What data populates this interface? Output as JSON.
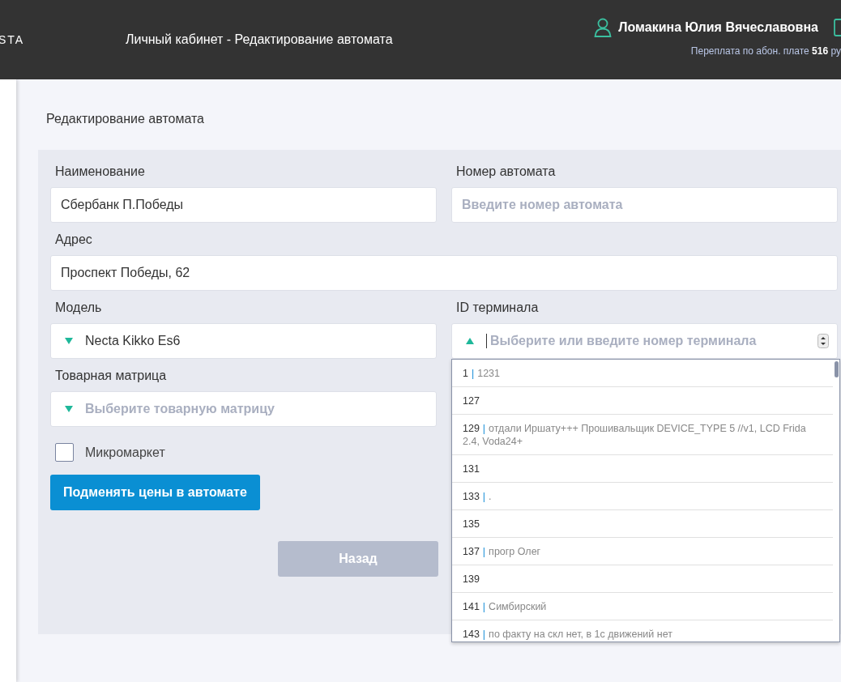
{
  "header": {
    "logo": "STA",
    "title": "Личный кабинет - Редактирование автомата",
    "user_name": "Ломакина Юлия Вячеславовна",
    "balance_note": "Переплата по абон. плате **516** ру"
  },
  "page_title": "Редактирование автомата",
  "fields": [
    {
      "label": "Наименование",
      "kind": "text",
      "value": "Сбербанк П.Победы",
      "wide": false
    },
    {
      "label": "Номер автомата",
      "kind": "text",
      "placeholder": "Введите номер автомата",
      "wide": false
    },
    {
      "label": "Адрес",
      "kind": "text",
      "value": "Проспект Победы, 62",
      "wide": true
    },
    {
      "label": "Модель",
      "kind": "select",
      "value": "Necta Kikko Es6",
      "expanded": false,
      "wide": false
    },
    {
      "label": "ID терминала",
      "kind": "select",
      "placeholder": "Выберите или введите номер терминала",
      "expanded": true,
      "wide": false,
      "options": [
        {
          "number": "1",
          "separator": "|",
          "note": "1231"
        },
        {
          "number": "127"
        },
        {
          "number": "129",
          "separator": "|",
          "note": "отдали Иршату+++ Прошивальщик DEVICE_TYPE 5 //v1, LCD Frida 2.4, Voda24+"
        },
        {
          "number": "131"
        },
        {
          "number": "133",
          "separator": "|",
          "note": "."
        },
        {
          "number": "135"
        },
        {
          "number": "137",
          "separator": "|",
          "note": "прогр Олег"
        },
        {
          "number": "139"
        },
        {
          "number": "141",
          "separator": "|",
          "note": "Симбирский"
        },
        {
          "number": "143",
          "separator": "|",
          "note": "по факту на скл нет, в 1с движений нет"
        }
      ]
    },
    {
      "label": "Товарная матрица",
      "kind": "select",
      "placeholder": "Выберите товарную матрицу",
      "expanded": false,
      "wide": false
    }
  ],
  "checkbox": {
    "label": "Микромаркет",
    "checked": false
  },
  "replace_prices_button": "Подменять цены в автомате",
  "back_button": "Назад"
}
